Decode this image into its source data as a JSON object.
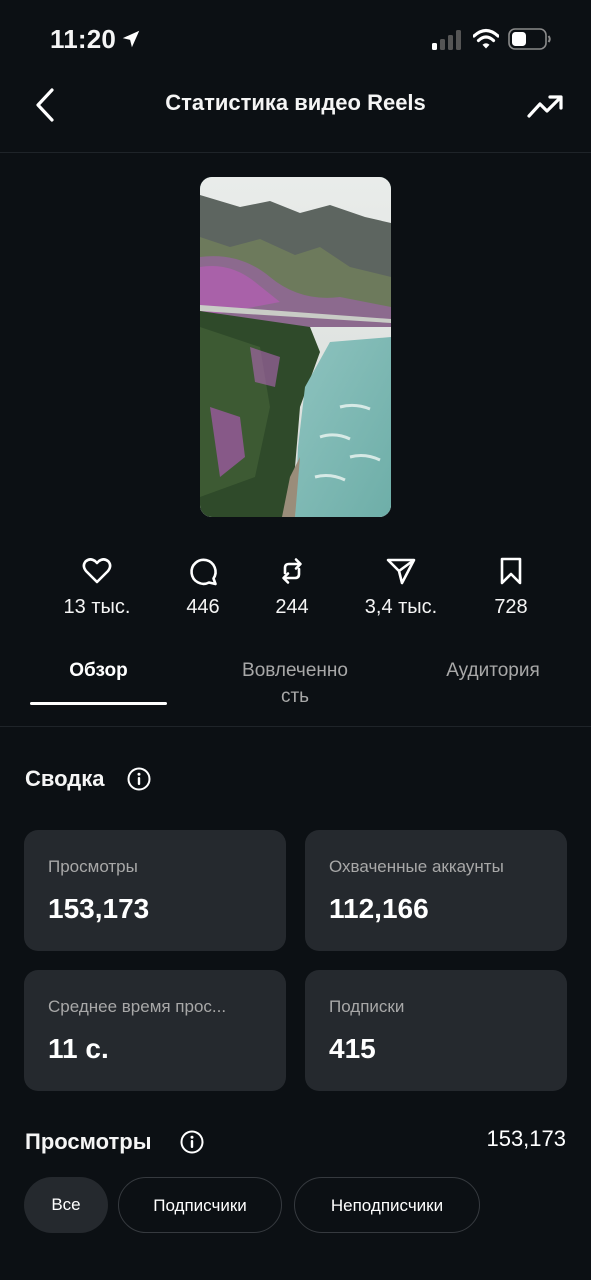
{
  "status_bar": {
    "time": "11:20",
    "icons": [
      "location-arrow-icon",
      "cellular-signal-icon",
      "wifi-icon",
      "battery-icon"
    ]
  },
  "header": {
    "title": "Статистика видео Reels",
    "back_icon": "chevron-left-icon",
    "trend_icon": "trending-up-icon"
  },
  "thumbnail": {
    "icon": "reel-thumbnail-mountain-river"
  },
  "stats": [
    {
      "icon": "heart-icon",
      "value": "13 тыс."
    },
    {
      "icon": "comment-icon",
      "value": "446"
    },
    {
      "icon": "repost-icon",
      "value": "244"
    },
    {
      "icon": "share-icon",
      "value": "3,4 тыс."
    },
    {
      "icon": "bookmark-icon",
      "value": "728"
    }
  ],
  "tabs": {
    "overview": "Обзор",
    "engagement_line1": "Вовлеченно",
    "engagement_line2": "сть",
    "audience": "Аудитория",
    "active": "overview"
  },
  "summary": {
    "title": "Сводка",
    "cards": [
      {
        "label": "Просмотры",
        "value": "153,173"
      },
      {
        "label": "Охваченные аккаунты",
        "value": "112,166"
      },
      {
        "label": "Среднее время прос...",
        "value": "11 с."
      },
      {
        "label": "Подписки",
        "value": "415"
      }
    ]
  },
  "views": {
    "title": "Просмотры",
    "total": "153,173",
    "filters": [
      "Все",
      "Подписчики",
      "Неподписчики"
    ],
    "active_filter": "Все"
  },
  "colors": {
    "background": "#0c1014",
    "card": "#25292e",
    "muted_text": "#a8a8a8",
    "text": "#ffffff"
  }
}
